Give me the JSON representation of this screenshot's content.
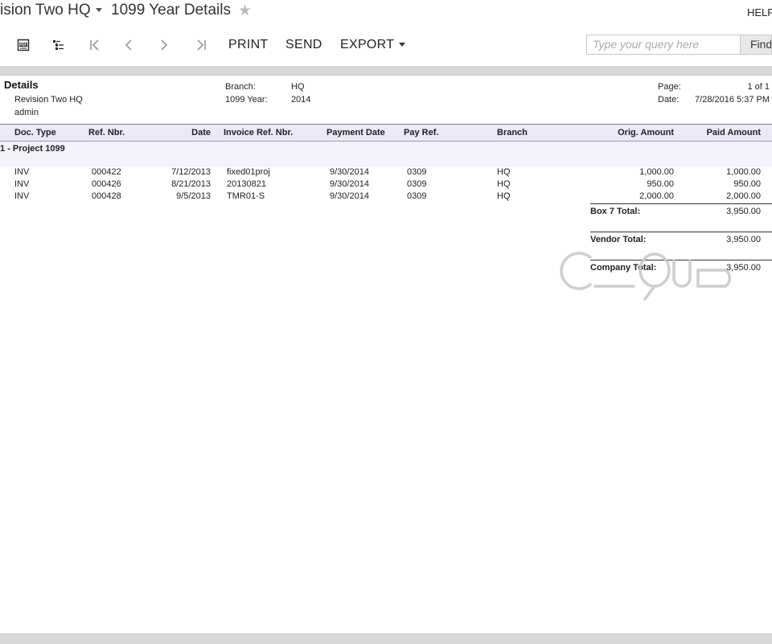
{
  "header": {
    "company_title": "ision Two HQ",
    "screen_title": "1099 Year Details",
    "help_label": "HELF"
  },
  "toolbar": {
    "print_label": "PRINT",
    "send_label": "SEND",
    "export_label": "EXPORT",
    "search_placeholder": "Type your query here",
    "find_label": "Find"
  },
  "report": {
    "title": "Details",
    "company": "Revision Two HQ",
    "user": "admin",
    "branch_label": "Branch:",
    "branch_value": "HQ",
    "year_label": "1099 Year:",
    "year_value": "2014",
    "page_label": "Page:",
    "page_value": "1 of 1",
    "date_label": "Date:",
    "date_value": "7/28/2016 5:37 PM",
    "columns": {
      "doc_type": "Doc. Type",
      "ref_nbr": "Ref. Nbr.",
      "date": "Date",
      "invoice_ref": "Invoice Ref. Nbr.",
      "payment_date": "Payment Date",
      "pay_ref": "Pay Ref.",
      "branch": "Branch",
      "orig_amount": "Orig. Amount",
      "paid_amount": "Paid Amount"
    },
    "group_label": "1 - Project 1099",
    "rows": [
      {
        "doc_type": "INV",
        "ref_nbr": "000422",
        "date": "7/12/2013",
        "invoice_ref": "fixed01proj",
        "payment_date": "9/30/2014",
        "pay_ref": "0309",
        "branch": "HQ",
        "orig_amount": "1,000.00",
        "paid_amount": "1,000.00"
      },
      {
        "doc_type": "INV",
        "ref_nbr": "000426",
        "date": "8/21/2013",
        "invoice_ref": "20130821",
        "payment_date": "9/30/2014",
        "pay_ref": "0309",
        "branch": "HQ",
        "orig_amount": "950.00",
        "paid_amount": "950.00"
      },
      {
        "doc_type": "INV",
        "ref_nbr": "000428",
        "date": "9/5/2013",
        "invoice_ref": "TMR01-S",
        "payment_date": "9/30/2014",
        "pay_ref": "0309",
        "branch": "HQ",
        "orig_amount": "2,000.00",
        "paid_amount": "2,000.00"
      }
    ],
    "totals": [
      {
        "label": "Box 7 Total:",
        "value": "3,950.00"
      },
      {
        "label": "Vendor Total:",
        "value": "3,950.00"
      },
      {
        "label": "Company Total:",
        "value": "3,950.00"
      }
    ],
    "watermark": "cloud"
  },
  "icons": {
    "pdf": "pdf-icon",
    "document_outline": "document-outline-icon",
    "first": "first-page-icon",
    "prev": "previous-page-icon",
    "next": "next-page-icon",
    "last": "last-page-icon",
    "star": "star-icon"
  }
}
